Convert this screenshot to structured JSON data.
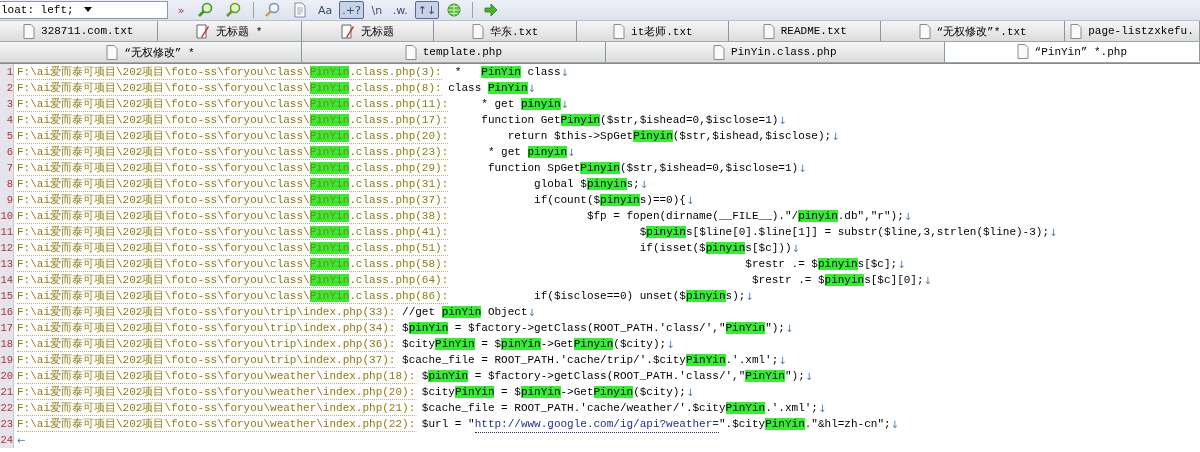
{
  "toolbar": {
    "search_value": "loat: left;",
    "buttons": [
      {
        "kind": "glyph",
        "label": "»",
        "pressed": false
      },
      {
        "kind": "find-green",
        "pressed": false
      },
      {
        "kind": "find-green-back",
        "pressed": false
      },
      {
        "kind": "separator"
      },
      {
        "kind": "find",
        "pressed": false
      },
      {
        "kind": "document",
        "pressed": false
      },
      {
        "kind": "glyph",
        "label": "Aa",
        "pressed": false
      },
      {
        "kind": "glyph",
        "label": ".+?",
        "pressed": true
      },
      {
        "kind": "glyph",
        "label": "\\n",
        "pressed": false
      },
      {
        "kind": "glyph",
        "label": ".w.",
        "pressed": false
      },
      {
        "kind": "glyph",
        "label": "↑↓",
        "pressed": true
      },
      {
        "kind": "globe",
        "pressed": false
      },
      {
        "kind": "separator"
      },
      {
        "kind": "arrow",
        "pressed": false
      }
    ]
  },
  "tab_rows": [
    [
      {
        "label": "328711.com.txt",
        "kind": "text-file",
        "selected": false
      },
      {
        "label": "无标题 *",
        "kind": "notepad",
        "selected": false
      },
      {
        "label": "无标题",
        "kind": "notepad",
        "selected": false
      },
      {
        "label": "华东.txt",
        "kind": "text-file",
        "selected": false
      },
      {
        "label": "it老师.txt",
        "kind": "text-file",
        "selected": false
      },
      {
        "label": "README.txt",
        "kind": "text-file",
        "selected": false
      },
      {
        "label": "“无权修改”*.txt",
        "kind": "text-file",
        "selected": false
      },
      {
        "label": "page-listzxkefu.",
        "kind": "text-file",
        "selected": false
      }
    ],
    [
      {
        "label": "“无权修改” *",
        "kind": "text-file",
        "selected": false
      },
      {
        "label": "template.php",
        "kind": "text-file",
        "selected": false
      },
      {
        "label": "PinYin.class.php",
        "kind": "text-file",
        "selected": false
      },
      {
        "label": "“PinYin” *.php",
        "kind": "text-file",
        "selected": true
      }
    ]
  ],
  "results": [
    {
      "number": "1",
      "path": [
        {
          "kind": "plain",
          "text": "F:\\ai爱而泰可项目\\202项目\\foto-ss\\foryou\\class\\"
        },
        {
          "kind": "match",
          "text": "PinYin"
        },
        {
          "kind": "plain",
          "text": ".class.php(3):"
        }
      ],
      "code": [
        {
          "kind": "plain",
          "text": "  *   "
        },
        {
          "kind": "match",
          "text": "PinYin"
        },
        {
          "kind": "plain",
          "text": " class"
        }
      ],
      "eol": "↓"
    },
    {
      "number": "2",
      "path": [
        {
          "kind": "plain",
          "text": "F:\\ai爱而泰可项目\\202项目\\foto-ss\\foryou\\class\\"
        },
        {
          "kind": "match",
          "text": "PinYin"
        },
        {
          "kind": "plain",
          "text": ".class.php(8):"
        }
      ],
      "code": [
        {
          "kind": "plain",
          "text": " class "
        },
        {
          "kind": "match",
          "text": "PinYin"
        }
      ],
      "eol": "↓"
    },
    {
      "number": "3",
      "path": [
        {
          "kind": "plain",
          "text": "F:\\ai爱而泰可项目\\202项目\\foto-ss\\foryou\\class\\"
        },
        {
          "kind": "match",
          "text": "PinYin"
        },
        {
          "kind": "plain",
          "text": ".class.php(11):"
        }
      ],
      "code": [
        {
          "kind": "plain",
          "text": "     * get "
        },
        {
          "kind": "match",
          "text": "pinyin"
        }
      ],
      "eol": "↓"
    },
    {
      "number": "4",
      "path": [
        {
          "kind": "plain",
          "text": "F:\\ai爱而泰可项目\\202项目\\foto-ss\\foryou\\class\\"
        },
        {
          "kind": "match",
          "text": "PinYin"
        },
        {
          "kind": "plain",
          "text": ".class.php(17):"
        }
      ],
      "code": [
        {
          "kind": "plain",
          "text": "     function Get"
        },
        {
          "kind": "match",
          "text": "Pinyin"
        },
        {
          "kind": "plain",
          "text": "($str,$ishead=0,$isclose=1)"
        }
      ],
      "eol": "↓"
    },
    {
      "number": "5",
      "path": [
        {
          "kind": "plain",
          "text": "F:\\ai爱而泰可项目\\202项目\\foto-ss\\foryou\\class\\"
        },
        {
          "kind": "match",
          "text": "PinYin"
        },
        {
          "kind": "plain",
          "text": ".class.php(20):"
        }
      ],
      "code": [
        {
          "kind": "plain",
          "text": "         return $this->SpGet"
        },
        {
          "kind": "match",
          "text": "Pinyin"
        },
        {
          "kind": "plain",
          "text": "($str,$ishead,$isclose);"
        }
      ],
      "eol": "↓"
    },
    {
      "number": "6",
      "path": [
        {
          "kind": "plain",
          "text": "F:\\ai爱而泰可项目\\202项目\\foto-ss\\foryou\\class\\"
        },
        {
          "kind": "match",
          "text": "PinYin"
        },
        {
          "kind": "plain",
          "text": ".class.php(23):"
        }
      ],
      "code": [
        {
          "kind": "plain",
          "text": "      * get "
        },
        {
          "kind": "match",
          "text": "pinyin"
        }
      ],
      "eol": "↓"
    },
    {
      "number": "7",
      "path": [
        {
          "kind": "plain",
          "text": "F:\\ai爱而泰可项目\\202项目\\foto-ss\\foryou\\class\\"
        },
        {
          "kind": "match",
          "text": "PinYin"
        },
        {
          "kind": "plain",
          "text": ".class.php(29):"
        }
      ],
      "code": [
        {
          "kind": "plain",
          "text": "      function SpGet"
        },
        {
          "kind": "match",
          "text": "Pinyin"
        },
        {
          "kind": "plain",
          "text": "($str,$ishead=0,$isclose=1)"
        }
      ],
      "eol": "↓"
    },
    {
      "number": "8",
      "path": [
        {
          "kind": "plain",
          "text": "F:\\ai爱而泰可项目\\202项目\\foto-ss\\foryou\\class\\"
        },
        {
          "kind": "match",
          "text": "PinYin"
        },
        {
          "kind": "plain",
          "text": ".class.php(31):"
        }
      ],
      "code": [
        {
          "kind": "plain",
          "text": "             global $"
        },
        {
          "kind": "match",
          "text": "pinyin"
        },
        {
          "kind": "plain",
          "text": "s;"
        }
      ],
      "eol": "↓"
    },
    {
      "number": "9",
      "path": [
        {
          "kind": "plain",
          "text": "F:\\ai爱而泰可项目\\202项目\\foto-ss\\foryou\\class\\"
        },
        {
          "kind": "match",
          "text": "PinYin"
        },
        {
          "kind": "plain",
          "text": ".class.php(37):"
        }
      ],
      "code": [
        {
          "kind": "plain",
          "text": "             if(count($"
        },
        {
          "kind": "match",
          "text": "pinyin"
        },
        {
          "kind": "plain",
          "text": "s)==0){"
        }
      ],
      "eol": "↓"
    },
    {
      "number": "10",
      "path": [
        {
          "kind": "plain",
          "text": "F:\\ai爱而泰可项目\\202项目\\foto-ss\\foryou\\class\\"
        },
        {
          "kind": "match",
          "text": "PinYin"
        },
        {
          "kind": "plain",
          "text": ".class.php(38):"
        }
      ],
      "code": [
        {
          "kind": "plain",
          "text": "                     $fp = fopen(dirname(__FILE__).\"/"
        },
        {
          "kind": "match",
          "text": "pinyin"
        },
        {
          "kind": "plain",
          "text": ".db\",\"r\");"
        }
      ],
      "eol": "↓"
    },
    {
      "number": "11",
      "path": [
        {
          "kind": "plain",
          "text": "F:\\ai爱而泰可项目\\202项目\\foto-ss\\foryou\\class\\"
        },
        {
          "kind": "match",
          "text": "PinYin"
        },
        {
          "kind": "plain",
          "text": ".class.php(41):"
        }
      ],
      "code": [
        {
          "kind": "plain",
          "text": "                             $"
        },
        {
          "kind": "match",
          "text": "pinyin"
        },
        {
          "kind": "plain",
          "text": "s[$line[0].$line[1]] = substr($line,3,strlen($line)-3);"
        }
      ],
      "eol": "↓"
    },
    {
      "number": "12",
      "path": [
        {
          "kind": "plain",
          "text": "F:\\ai爱而泰可项目\\202项目\\foto-ss\\foryou\\class\\"
        },
        {
          "kind": "match",
          "text": "PinYin"
        },
        {
          "kind": "plain",
          "text": ".class.php(51):"
        }
      ],
      "code": [
        {
          "kind": "plain",
          "text": "                             if(isset($"
        },
        {
          "kind": "match",
          "text": "pinyin"
        },
        {
          "kind": "plain",
          "text": "s[$c]))"
        }
      ],
      "eol": "↓"
    },
    {
      "number": "13",
      "path": [
        {
          "kind": "plain",
          "text": "F:\\ai爱而泰可项目\\202项目\\foto-ss\\foryou\\class\\"
        },
        {
          "kind": "match",
          "text": "PinYin"
        },
        {
          "kind": "plain",
          "text": ".class.php(58):"
        }
      ],
      "code": [
        {
          "kind": "plain",
          "text": "                                             $restr .= $"
        },
        {
          "kind": "match",
          "text": "pinyin"
        },
        {
          "kind": "plain",
          "text": "s[$c];"
        }
      ],
      "eol": "↓"
    },
    {
      "number": "14",
      "path": [
        {
          "kind": "plain",
          "text": "F:\\ai爱而泰可项目\\202项目\\foto-ss\\foryou\\class\\"
        },
        {
          "kind": "match",
          "text": "PinYin"
        },
        {
          "kind": "plain",
          "text": ".class.php(64):"
        }
      ],
      "code": [
        {
          "kind": "plain",
          "text": "                                              $restr .= $"
        },
        {
          "kind": "match",
          "text": "pinyin"
        },
        {
          "kind": "plain",
          "text": "s[$c][0];"
        }
      ],
      "eol": "↓"
    },
    {
      "number": "15",
      "path": [
        {
          "kind": "plain",
          "text": "F:\\ai爱而泰可项目\\202项目\\foto-ss\\foryou\\class\\"
        },
        {
          "kind": "match",
          "text": "PinYin"
        },
        {
          "kind": "plain",
          "text": ".class.php(86):"
        }
      ],
      "code": [
        {
          "kind": "plain",
          "text": "             if($isclose==0) unset($"
        },
        {
          "kind": "match",
          "text": "pinyin"
        },
        {
          "kind": "plain",
          "text": "s);"
        }
      ],
      "eol": "↓"
    },
    {
      "number": "16",
      "path": [
        {
          "kind": "plain",
          "text": "F:\\ai爱而泰可项目\\202项目\\foto-ss\\foryou\\trip\\index.php(33):"
        }
      ],
      "code": [
        {
          "kind": "plain",
          "text": " //get "
        },
        {
          "kind": "match",
          "text": "pinYin"
        },
        {
          "kind": "plain",
          "text": " Object"
        }
      ],
      "eol": "↓"
    },
    {
      "number": "17",
      "path": [
        {
          "kind": "plain",
          "text": "F:\\ai爱而泰可项目\\202项目\\foto-ss\\foryou\\trip\\index.php(34):"
        }
      ],
      "code": [
        {
          "kind": "plain",
          "text": " $"
        },
        {
          "kind": "match",
          "text": "pinYin"
        },
        {
          "kind": "plain",
          "text": " = $factory->getClass(ROOT_PATH.'class/',\""
        },
        {
          "kind": "match",
          "text": "PinYin"
        },
        {
          "kind": "plain",
          "text": "\");"
        }
      ],
      "eol": "↓"
    },
    {
      "number": "18",
      "path": [
        {
          "kind": "plain",
          "text": "F:\\ai爱而泰可项目\\202项目\\foto-ss\\foryou\\trip\\index.php(36):"
        }
      ],
      "code": [
        {
          "kind": "plain",
          "text": " $city"
        },
        {
          "kind": "match",
          "text": "PinYin"
        },
        {
          "kind": "plain",
          "text": " = $"
        },
        {
          "kind": "match",
          "text": "pinYin"
        },
        {
          "kind": "plain",
          "text": "->Get"
        },
        {
          "kind": "match",
          "text": "Pinyin"
        },
        {
          "kind": "plain",
          "text": "($city);"
        }
      ],
      "eol": "↓"
    },
    {
      "number": "19",
      "path": [
        {
          "kind": "plain",
          "text": "F:\\ai爱而泰可项目\\202项目\\foto-ss\\foryou\\trip\\index.php(37):"
        }
      ],
      "code": [
        {
          "kind": "plain",
          "text": " $cache_file = ROOT_PATH.'cache/trip/'.$city"
        },
        {
          "kind": "match",
          "text": "PinYin"
        },
        {
          "kind": "plain",
          "text": ".'.xml';"
        }
      ],
      "eol": "↓"
    },
    {
      "number": "20",
      "path": [
        {
          "kind": "plain",
          "text": "F:\\ai爱而泰可项目\\202项目\\foto-ss\\foryou\\weather\\index.php(18):"
        }
      ],
      "code": [
        {
          "kind": "plain",
          "text": " $"
        },
        {
          "kind": "match",
          "text": "pinYin"
        },
        {
          "kind": "plain",
          "text": " = $factory->getClass(ROOT_PATH.'class/',\""
        },
        {
          "kind": "match",
          "text": "PinYin"
        },
        {
          "kind": "plain",
          "text": "\");"
        }
      ],
      "eol": "↓"
    },
    {
      "number": "21",
      "path": [
        {
          "kind": "plain",
          "text": "F:\\ai爱而泰可项目\\202项目\\foto-ss\\foryou\\weather\\index.php(20):"
        }
      ],
      "code": [
        {
          "kind": "plain",
          "text": " $city"
        },
        {
          "kind": "match",
          "text": "PinYin"
        },
        {
          "kind": "plain",
          "text": " = $"
        },
        {
          "kind": "match",
          "text": "pinYin"
        },
        {
          "kind": "plain",
          "text": "->Get"
        },
        {
          "kind": "match",
          "text": "Pinyin"
        },
        {
          "kind": "plain",
          "text": "($city);"
        }
      ],
      "eol": "↓"
    },
    {
      "number": "22",
      "path": [
        {
          "kind": "plain",
          "text": "F:\\ai爱而泰可项目\\202项目\\foto-ss\\foryou\\weather\\index.php(21):"
        }
      ],
      "code": [
        {
          "kind": "plain",
          "text": " $cache_file = ROOT_PATH.'cache/weather/'.$city"
        },
        {
          "kind": "match",
          "text": "PinYin"
        },
        {
          "kind": "plain",
          "text": ".'.xml';"
        }
      ],
      "eol": "↓"
    },
    {
      "number": "23",
      "path": [
        {
          "kind": "plain",
          "text": "F:\\ai爱而泰可项目\\202项目\\foto-ss\\foryou\\weather\\index.php(22):"
        }
      ],
      "code": [
        {
          "kind": "plain",
          "text": " $url = \""
        },
        {
          "kind": "link",
          "text": "http://www.google.com/ig/api?weather="
        },
        {
          "kind": "plain",
          "text": "\".$city"
        },
        {
          "kind": "match",
          "text": "PinYin"
        },
        {
          "kind": "plain",
          "text": ".\"&hl=zh-cn\";"
        }
      ],
      "eol": "↓"
    },
    {
      "number": "24",
      "eol": "←"
    }
  ]
}
